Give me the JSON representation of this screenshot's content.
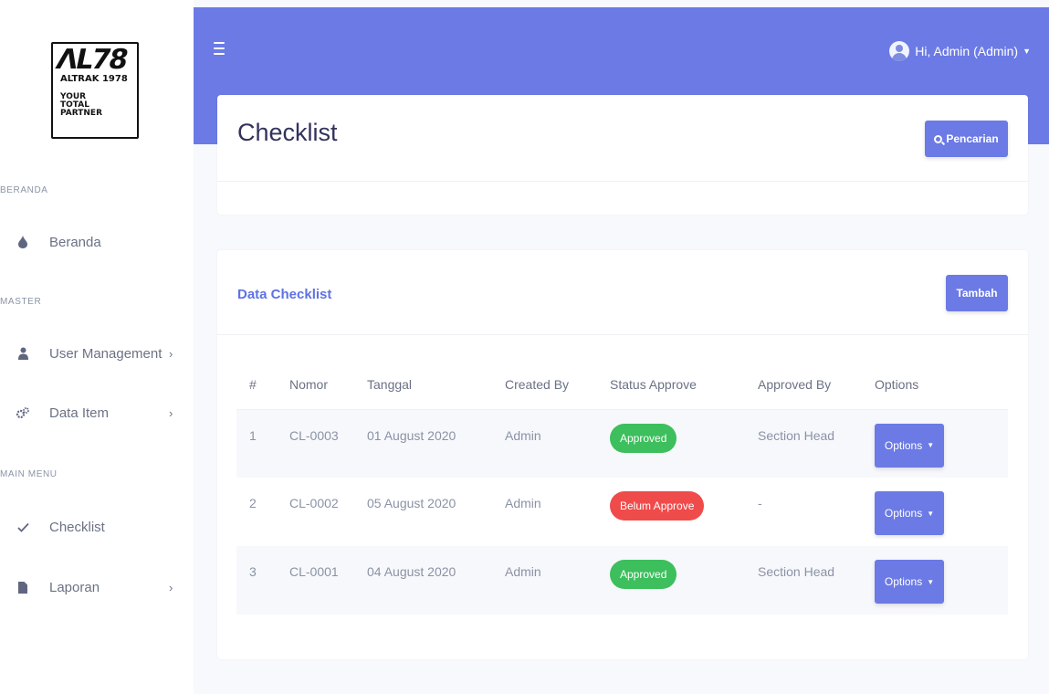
{
  "logo": {
    "mark": "ΛL78",
    "sub": "ALTRAK 1978",
    "tagline": "YOUR\nTOTAL\nPARTNER"
  },
  "sidebar": {
    "sections": [
      {
        "label": "BERANDA"
      },
      {
        "label": "MASTER"
      },
      {
        "label": "MAIN MENU"
      }
    ],
    "items": [
      {
        "label": "Beranda",
        "icon": "drop-icon"
      },
      {
        "label": "User Management",
        "icon": "user-icon"
      },
      {
        "label": "Data Item",
        "icon": "gears-icon"
      },
      {
        "label": "Checklist",
        "icon": "check-icon"
      },
      {
        "label": "Laporan",
        "icon": "file-icon"
      }
    ]
  },
  "header": {
    "user_label": "Hi, Admin (Admin)"
  },
  "page": {
    "title": "Checklist",
    "search_label": "Pencarian"
  },
  "card": {
    "title": "Data Checklist",
    "add_label": "Tambah"
  },
  "table": {
    "columns": [
      "#",
      "Nomor",
      "Tanggal",
      "Created By",
      "Status Approve",
      "Approved By",
      "Options"
    ],
    "rows": [
      {
        "no": "1",
        "nomor": "CL-0003",
        "tanggal": "01 August 2020",
        "created_by": "Admin",
        "status": "Approved",
        "approved_by": "Section Head",
        "options": "Options"
      },
      {
        "no": "2",
        "nomor": "CL-0002",
        "tanggal": "05 August 2020",
        "created_by": "Admin",
        "status": "Belum Approve",
        "approved_by": "-",
        "options": "Options"
      },
      {
        "no": "3",
        "nomor": "CL-0001",
        "tanggal": "04 August 2020",
        "created_by": "Admin",
        "status": "Approved",
        "approved_by": "Section Head",
        "options": "Options"
      }
    ]
  },
  "colors": {
    "primary": "#6b7ae5",
    "approved": "#3cbf5c",
    "pending": "#f04b4b"
  }
}
